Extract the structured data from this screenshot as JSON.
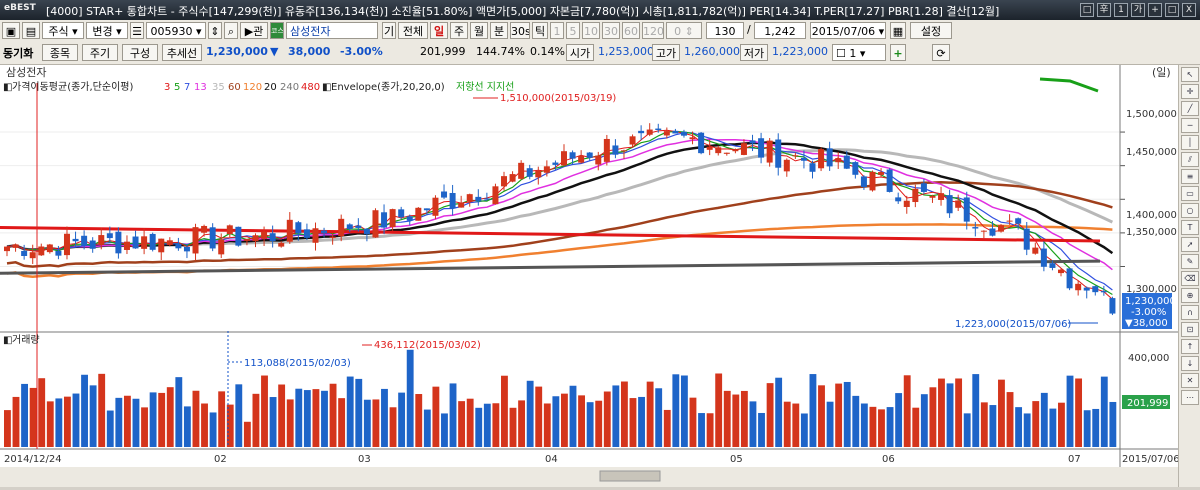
{
  "title_bar": {
    "logo": "eBEST",
    "title": "[4000] STAR+ 통합차트 - 주식수[147,299(천)] 유동주[136,134(천)] 소진율[51.80%] 액면가[5,000] 자본금[7,780(억)] 시총[1,811,782(억)] PER[14.34] T.PER[17.27] PBR[1.28] 결산[12월]",
    "buttons": [
      "□",
      "辛",
      "1",
      "가",
      "+",
      "□",
      "X"
    ]
  },
  "toolbar1": {
    "market": "주식",
    "change": "변경",
    "code": "005930",
    "relation": "관",
    "exchange_badge": "코스",
    "name": "삼성전자",
    "period_buttons": [
      "기",
      "전체",
      "일",
      "주",
      "월",
      "분",
      "30s",
      "틱"
    ],
    "interval_buttons": [
      "1",
      "5",
      "10",
      "30",
      "60",
      "120"
    ],
    "count_zero": "0",
    "count": "130",
    "total": "1,242",
    "date": "2015/07/06",
    "settings": "설정"
  },
  "toolbar2": {
    "sync": "동기화",
    "stock_list": "종목",
    "cycle": "주기",
    "compose": "구성",
    "trendline": "추세선",
    "price": "1,230,000",
    "change_arrow": "▼",
    "change": "38,000",
    "change_pct": "-3.00%",
    "volume": "201,999",
    "vol_ratio": "144.74%",
    "turnover": "0.14%",
    "open_label": "시가",
    "open": "1,253,000",
    "high_label": "고가",
    "high": "1,260,000",
    "low_label": "저가",
    "low": "1,223,000",
    "select_value": "1"
  },
  "price_panel": {
    "stock_name": "삼성전자",
    "unit": "(일)",
    "ma_label": "가격이동평균(종가,단순이평)",
    "ma_periods": [
      "3",
      "5",
      "7",
      "13",
      "35",
      "60",
      "120",
      "20",
      "240",
      "480"
    ],
    "envelope_label": "Envelope(종가,20,20,0)",
    "support_label": "저항선 지지선",
    "high_annotation": "1,510,000(2015/03/19)",
    "low_annotation": "1,223,000(2015/07/06)",
    "y_ticks": [
      "1,500,000",
      "1,450,000",
      "1,400,000",
      "1,350,000",
      "1,300,000"
    ],
    "last_price": "1,230,000",
    "last_change_pct": "-3.00%",
    "last_change": "▼38,000"
  },
  "volume_panel": {
    "label": "거래량",
    "max_annotation": "436,112(2015/03/02)",
    "min_annotation": "113,088(2015/02/03)",
    "y_tick": "400,000",
    "last_volume": "201,999"
  },
  "x_axis": {
    "labels": [
      "2014/12/24",
      "02",
      "03",
      "04",
      "05",
      "06",
      "07",
      "2015/07/06"
    ]
  },
  "colors": {
    "up": "#d4351c",
    "down": "#1e64c8",
    "ma_black": "#111111",
    "ma_gray": "#b8b8b8",
    "ma_brown": "#a0401c",
    "ma_orange": "#f08030",
    "ma_darkgray": "#555555",
    "ma_red": "#e01818",
    "ma_green": "#18a018",
    "ma_magenta": "#e030e0",
    "ma_blue": "#3050e0"
  },
  "chart_data": {
    "type": "candlestick",
    "title": "삼성전자",
    "x_range": [
      "2014/12/24",
      "2015/07/06"
    ],
    "ylim": [
      1210000,
      1570000
    ],
    "price_high": {
      "date": "2015/03/19",
      "value": 1510000
    },
    "price_low": {
      "date": "2015/07/06",
      "value": 1223000
    },
    "last": {
      "date": "2015/07/06",
      "open": 1253000,
      "high": 1260000,
      "low": 1223000,
      "close": 1230000,
      "change": -38000,
      "change_pct": -3.0,
      "volume": 201999
    },
    "volume_max": {
      "date": "2015/03/02",
      "value": 436112
    },
    "volume_min": {
      "date": "2015/02/03",
      "value": 113088
    },
    "monthly_closes": [
      {
        "x": "2014/12/24",
        "close": 1330000
      },
      {
        "x": "2015/01",
        "close": 1340000
      },
      {
        "x": "2015/02",
        "close": 1365000
      },
      {
        "x": "2015/03",
        "close": 1475000
      },
      {
        "x": "2015/04",
        "close": 1450000
      },
      {
        "x": "2015/05",
        "close": 1385000
      },
      {
        "x": "2015/06",
        "close": 1290000
      },
      {
        "x": "2015/07/06",
        "close": 1230000
      }
    ]
  }
}
